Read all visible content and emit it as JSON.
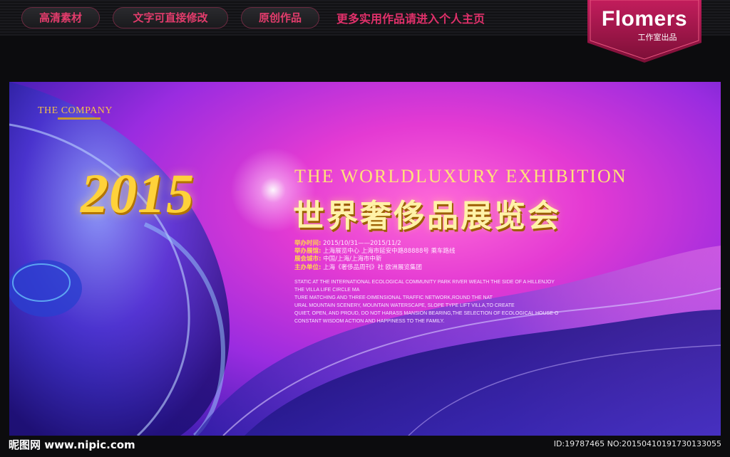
{
  "topbar": {
    "tabs": [
      "高清素材",
      "文字可直接修改",
      "原创作品"
    ],
    "note": "更多实用作品请进入个人主页",
    "brand": "Flomers",
    "brand_sub": "工作室出品"
  },
  "poster": {
    "company": "THE COMPANY",
    "year": "2015",
    "title_en": "THE WORLDLUXURY EXHIBITION",
    "title_cn": "世界奢侈品展览会",
    "info": [
      {
        "label": "举办时间:",
        "value": "2015/10/31——2015/11/2"
      },
      {
        "label": "举办展馆:",
        "value": "上海展览中心 上海市延安中路88888号 乘车路线"
      },
      {
        "label": "展会城市:",
        "value": "中国/上海/上海市中新"
      },
      {
        "label": "主办单位:",
        "value": "上海《奢侈品周刊》社 欧洲展览集团"
      }
    ],
    "description": [
      "STATIC AT THE INTERNATIONAL ECOLOGICAL COMMUNITY PARK RIVER WEALTH THE SIDE OF A HILLENJOY",
      "THE VILLA LIFE CIRCLE MA",
      "TURE MATCHING AND THREE-DIMENSIONAL TRAFFIC NETWORK,ROUND THE NAT",
      "URAL MOUNTAIN SCENERY, MOUNTAIN WATERSCAPE, SLOPE TYPE LIFT VILLA,TO CREATE",
      "QUIET, OPEN, AND PROUD, DO NOT HARASS MANSION BEARING,THE SELECTION OF ECOLOGICAL HOUSE O",
      "CONSTANT WISDOM ACTION AND HAPPINESS TO THE FAMILY."
    ]
  },
  "footer": {
    "site": "昵图网 www.nipic.com",
    "id": "ID:19787465 NO:20150410191730133055"
  },
  "colors": {
    "accent": "#e33c6c",
    "gold": "#ffd23a",
    "poster_pink": "#e43ad3",
    "poster_blue": "#2a1680"
  }
}
